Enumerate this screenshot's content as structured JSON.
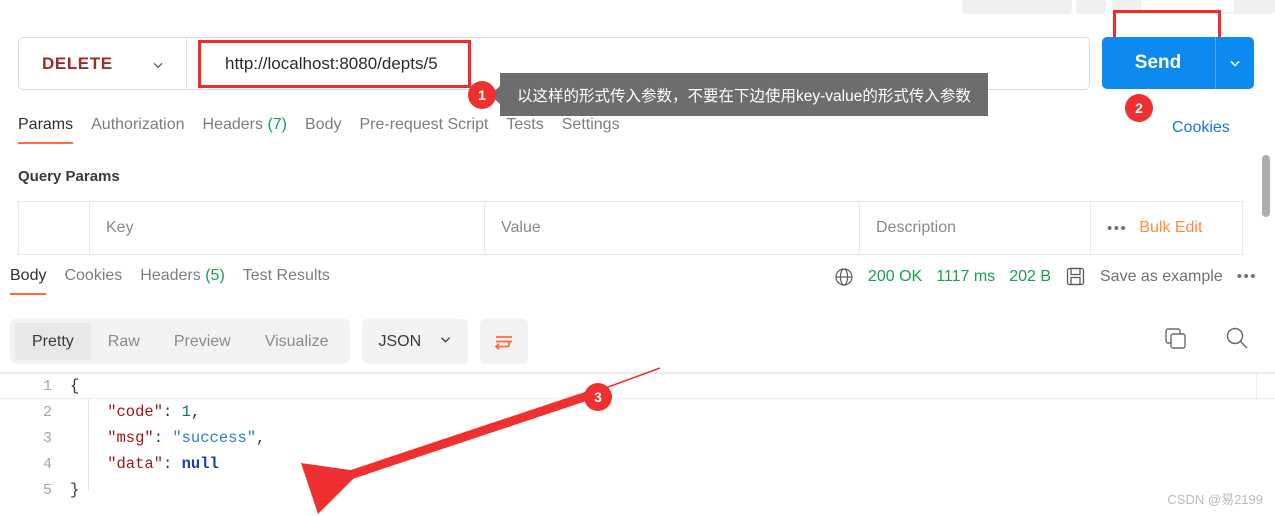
{
  "request": {
    "method": "DELETE",
    "url": "http://localhost:8080/depts/5",
    "send_label": "Send",
    "cookies_link": "Cookies",
    "tabs": [
      {
        "label": "Params",
        "count": "",
        "active": true
      },
      {
        "label": "Authorization",
        "count": "",
        "active": false
      },
      {
        "label": "Headers",
        "count": "(7)",
        "active": false
      },
      {
        "label": "Body",
        "count": "",
        "active": false
      },
      {
        "label": "Pre-request Script",
        "count": "",
        "active": false
      },
      {
        "label": "Tests",
        "count": "",
        "active": false
      },
      {
        "label": "Settings",
        "count": "",
        "active": false
      }
    ],
    "query_params_title": "Query Params",
    "params_table": {
      "columns": [
        "Key",
        "Value",
        "Description"
      ],
      "bulk_edit_label": "Bulk Edit",
      "more_dots": "•••",
      "rows": []
    }
  },
  "response": {
    "tabs": [
      {
        "label": "Body",
        "count": "",
        "active": true
      },
      {
        "label": "Cookies",
        "count": "",
        "active": false
      },
      {
        "label": "Headers",
        "count": "(5)",
        "active": false
      },
      {
        "label": "Test Results",
        "count": "",
        "active": false
      }
    ],
    "status": {
      "code": "200 OK",
      "time": "1117 ms",
      "size": "202 B",
      "save_as_example": "Save as example",
      "more_dots": "•••"
    },
    "toolbar": {
      "views": [
        {
          "label": "Pretty",
          "active": true
        },
        {
          "label": "Raw",
          "active": false
        },
        {
          "label": "Preview",
          "active": false
        },
        {
          "label": "Visualize",
          "active": false
        }
      ],
      "format": "JSON"
    },
    "body": {
      "lines": [
        {
          "num": "1",
          "tokens": [
            {
              "t": "{",
              "c": "tok-punc"
            }
          ]
        },
        {
          "num": "2",
          "tokens": [
            {
              "t": "    \"code\"",
              "c": "tok-key"
            },
            {
              "t": ": ",
              "c": "tok-punc"
            },
            {
              "t": "1",
              "c": "tok-num"
            },
            {
              "t": ",",
              "c": "tok-punc"
            }
          ]
        },
        {
          "num": "3",
          "tokens": [
            {
              "t": "    \"msg\"",
              "c": "tok-key"
            },
            {
              "t": ": ",
              "c": "tok-punc"
            },
            {
              "t": "\"success\"",
              "c": "tok-str"
            },
            {
              "t": ",",
              "c": "tok-punc"
            }
          ]
        },
        {
          "num": "4",
          "tokens": [
            {
              "t": "    \"data\"",
              "c": "tok-key"
            },
            {
              "t": ": ",
              "c": "tok-punc"
            },
            {
              "t": "null",
              "c": "tok-null"
            }
          ]
        },
        {
          "num": "5",
          "tokens": [
            {
              "t": "}",
              "c": "tok-punc"
            }
          ]
        }
      ]
    }
  },
  "annotations": {
    "tooltip_text": "以这样的形式传入参数，不要在下边使用key-value的形式传入参数",
    "marker_1": "1",
    "marker_2": "2",
    "marker_3": "3",
    "accent_red": "#ef2b2b",
    "accent_orange": "#ff6c37",
    "accent_blue": "#0d8af0",
    "accent_green": "#1a9c52"
  },
  "watermark": "CSDN @易2199"
}
